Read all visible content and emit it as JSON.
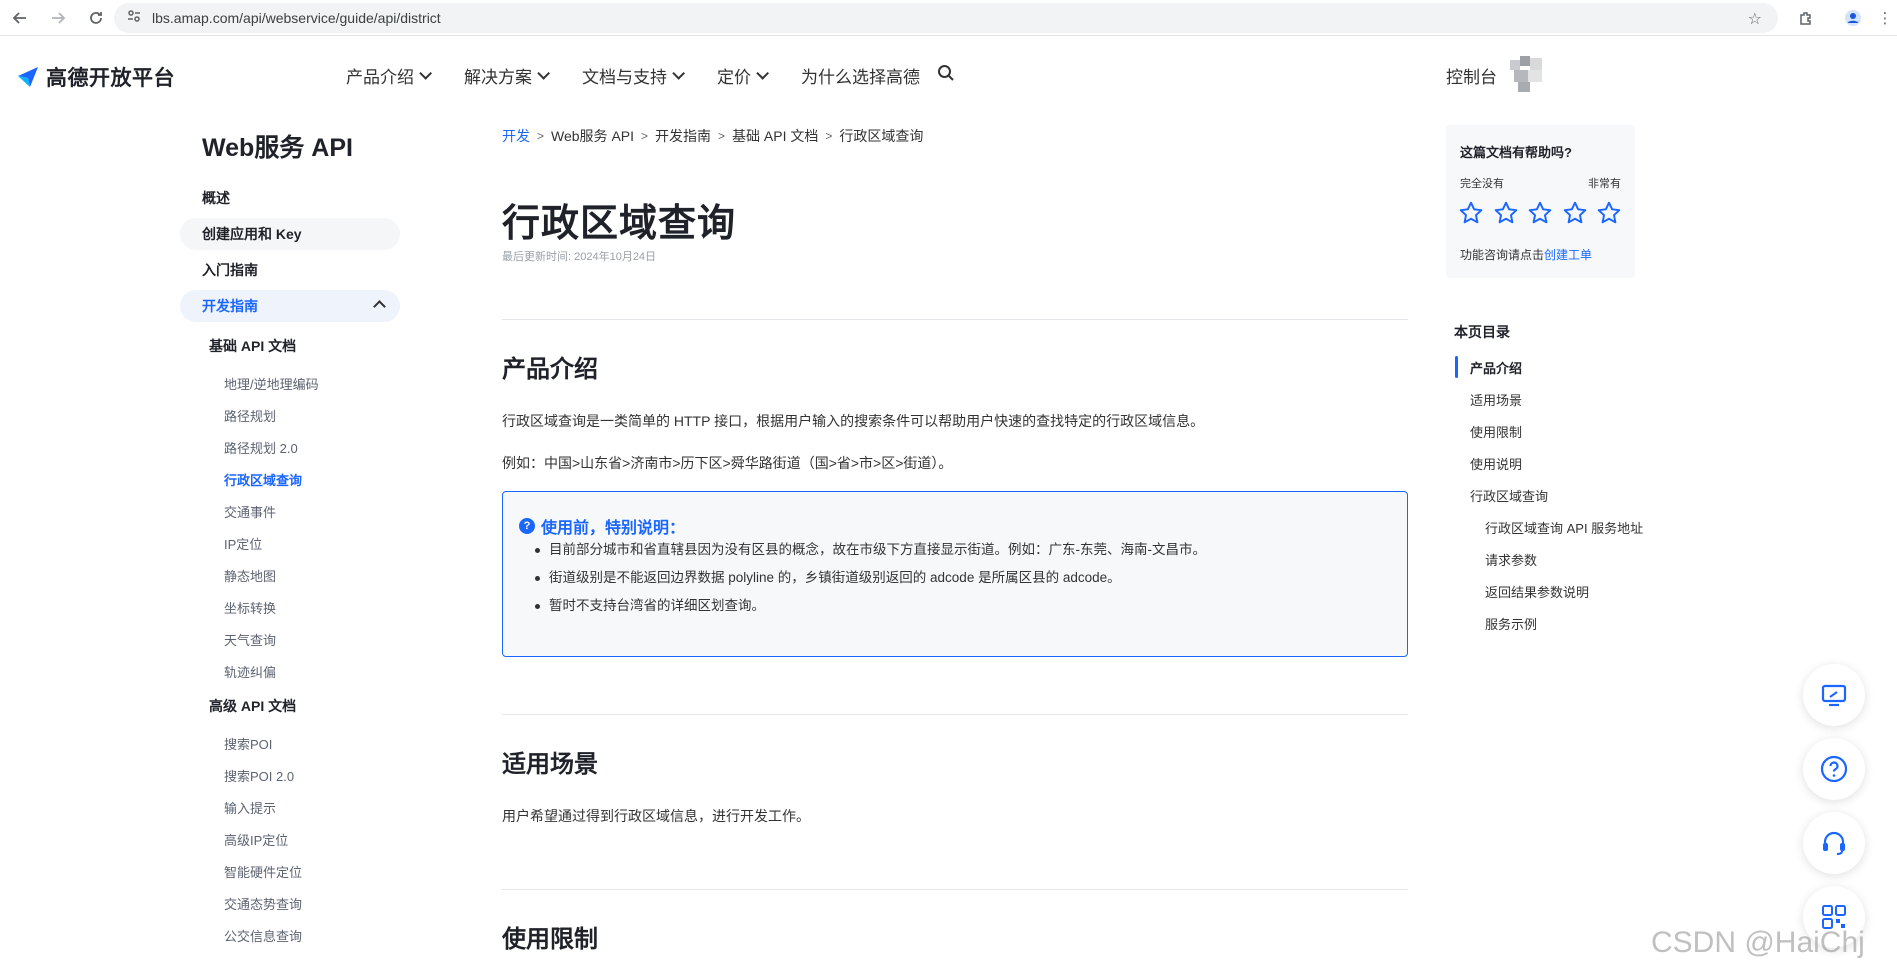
{
  "browser": {
    "url": "lbs.amap.com/api/webservice/guide/api/district"
  },
  "header": {
    "logo_text": "高德开放平台",
    "nav": [
      "产品介绍",
      "解决方案",
      "文档与支持",
      "定价",
      "为什么选择高德"
    ],
    "console": "控制台"
  },
  "sidebar": {
    "title": "Web服务 API",
    "items": [
      "概述",
      "创建应用和 Key",
      "入门指南",
      "开发指南"
    ],
    "groups": [
      {
        "label": "基础 API 文档",
        "items": [
          "地理/逆地理编码",
          "路径规划",
          "路径规划 2.0",
          "行政区域查询",
          "交通事件",
          "IP定位",
          "静态地图",
          "坐标转换",
          "天气查询",
          "轨迹纠偏"
        ]
      },
      {
        "label": "高级 API 文档",
        "items": [
          "搜索POI",
          "搜索POI 2.0",
          "输入提示",
          "高级IP定位",
          "智能硬件定位",
          "交通态势查询",
          "公交信息查询"
        ]
      }
    ]
  },
  "breadcrumb": [
    "开发",
    "Web服务 API",
    "开发指南",
    "基础 API 文档",
    "行政区域查询"
  ],
  "main": {
    "title": "行政区域查询",
    "updated": "最后更新时间: 2024年10月24日",
    "section1": {
      "title": "产品介绍",
      "p1": "行政区域查询是一类简单的 HTTP 接口，根据用户输入的搜索条件可以帮助用户快速的查找特定的行政区域信息。",
      "p2": "例如：中国>山东省>济南市>历下区>舜华路街道（国>省>市>区>街道）。"
    },
    "notice": {
      "title": "使用前，特别说明：",
      "items": [
        "目前部分城市和省直辖县因为没有区县的概念，故在市级下方直接显示街道。例如：广东-东莞、海南-文昌市。",
        "街道级别是不能返回边界数据 polyline 的，乡镇街道级别返回的 adcode 是所属区县的 adcode。",
        "暂时不支持台湾省的详细区划查询。"
      ]
    },
    "section2": {
      "title": "适用场景",
      "p1": "用户希望通过得到行政区域信息，进行开发工作。"
    },
    "section3": {
      "title": "使用限制"
    }
  },
  "feedback": {
    "title": "这篇文档有帮助吗?",
    "low": "完全没有",
    "high": "非常有",
    "foot_prefix": "功能咨询请点击",
    "foot_link": "创建工单"
  },
  "toc": {
    "title": "本页目录",
    "items": [
      "产品介绍",
      "适用场景",
      "使用限制",
      "使用说明",
      "行政区域查询",
      "行政区域查询 API 服务地址",
      "请求参数",
      "返回结果参数说明",
      "服务示例"
    ]
  },
  "watermark": "CSDN @HaiChj",
  "colors": {
    "accent": "#1a66ff",
    "text": "#1f2329",
    "muted": "#5c6370"
  }
}
